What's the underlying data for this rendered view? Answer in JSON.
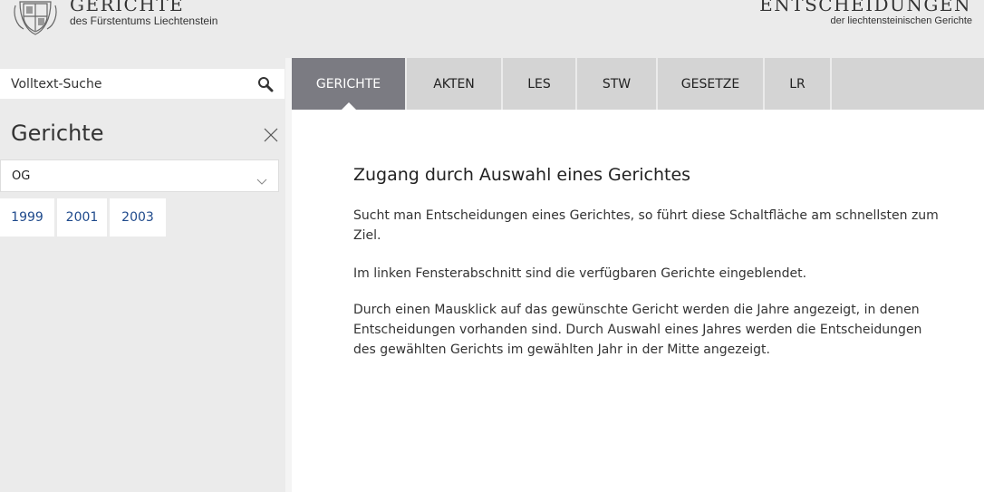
{
  "header": {
    "title": "GERICHTE",
    "subtitle": "des Fürstentums Liechtenstein",
    "right_title": "ENTSCHEIDUNGEN",
    "right_subtitle": "der liechtensteinischen Gerichte",
    "crest_icon": "coat-of-arms-icon"
  },
  "search": {
    "placeholder": "Volltext-Suche",
    "value": "",
    "icon": "search-icon"
  },
  "sidebar": {
    "title": "Gerichte",
    "close_icon": "close-icon",
    "select": {
      "value": "OG",
      "icon": "chevron-down-icon"
    },
    "years": [
      {
        "label": "1999"
      },
      {
        "label": "2001"
      },
      {
        "label": "2003"
      }
    ]
  },
  "tabs": [
    {
      "label": "GERICHTE",
      "active": true
    },
    {
      "label": "AKTEN",
      "active": false
    },
    {
      "label": "LES",
      "active": false
    },
    {
      "label": "STW",
      "active": false
    },
    {
      "label": "GESETZE",
      "active": false
    },
    {
      "label": "LR",
      "active": false
    }
  ],
  "main": {
    "heading": "Zugang durch Auswahl eines Gerichtes",
    "paragraphs": [
      "Sucht man Entscheidungen eines Gerichtes, so führt diese Schaltfläche am schnellsten zum Ziel.",
      "Im linken Fensterabschnitt sind die verfügbaren Gerichte eingeblendet.",
      "Durch einen Mausklick auf das gewünschte Gericht werden die Jahre angezeigt, in denen Entscheidungen vorhanden sind. Durch Auswahl eines Jahres werden die Entscheidungen des gewählten Gerichts im gewählten Jahr in der Mitte angezeigt."
    ]
  },
  "colors": {
    "page_bg": "#ebebeb",
    "tab_bar": "#d4d4d4",
    "tab_active": "#7b7b82",
    "year_link": "#1f4a8c"
  }
}
